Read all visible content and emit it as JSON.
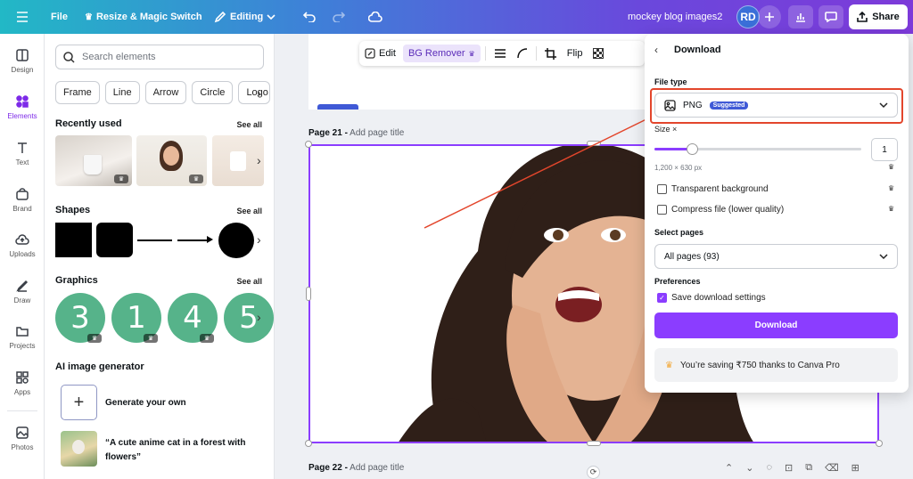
{
  "topbar": {
    "file_label": "File",
    "resize_label": "Resize & Magic Switch",
    "editing_label": "Editing",
    "doc_title": "mockey blog images2",
    "avatar_initials": "RD",
    "share_label": "Share"
  },
  "rail": {
    "items": [
      {
        "label": "Design",
        "icon": "design-icon"
      },
      {
        "label": "Elements",
        "icon": "elements-icon"
      },
      {
        "label": "Text",
        "icon": "text-icon"
      },
      {
        "label": "Brand",
        "icon": "brand-icon"
      },
      {
        "label": "Uploads",
        "icon": "uploads-icon"
      },
      {
        "label": "Draw",
        "icon": "draw-icon"
      },
      {
        "label": "Projects",
        "icon": "projects-icon"
      },
      {
        "label": "Apps",
        "icon": "apps-icon"
      },
      {
        "label": "Photos",
        "icon": "photos-icon"
      }
    ]
  },
  "elements_panel": {
    "search_placeholder": "Search elements",
    "chips": [
      "Frame",
      "Line",
      "Arrow",
      "Circle",
      "Logo"
    ],
    "recently_used_title": "Recently used",
    "shapes_title": "Shapes",
    "graphics_title": "Graphics",
    "see_all": "See all",
    "graphics_numbers": [
      "3",
      "1",
      "4",
      "5"
    ],
    "ai_title": "AI image generator",
    "generate_label": "Generate your own",
    "prompt_example": "“A cute anime cat in a forest with flowers”"
  },
  "canvas": {
    "page21_num": "Page 21 -",
    "page21_title": "Add page title",
    "page22_num": "Page 22 -",
    "page22_title": "Add page title"
  },
  "image_toolbar": {
    "edit_label": "Edit",
    "bg_remover_label": "BG Remover",
    "flip_label": "Flip"
  },
  "download_panel": {
    "title": "Download",
    "file_type_label": "File type",
    "file_type_value": "PNG",
    "suggested_badge": "Suggested",
    "size_label": "Size ×",
    "size_value": "1",
    "size_slider_fraction": 0.18,
    "dimensions": "1,200 × 630 px",
    "transparent_label": "Transparent background",
    "compress_label": "Compress file (lower quality)",
    "select_pages_label": "Select pages",
    "pages_value": "All pages (93)",
    "preferences_label": "Preferences",
    "save_settings_label": "Save download settings",
    "save_settings_checked": true,
    "download_button": "Download",
    "saving_text": "You’re saving ₹750 thanks to Canva Pro"
  },
  "colors": {
    "accent": "#8b3dff",
    "highlight": "#e3462c",
    "graphic_green": "#56b38a"
  }
}
